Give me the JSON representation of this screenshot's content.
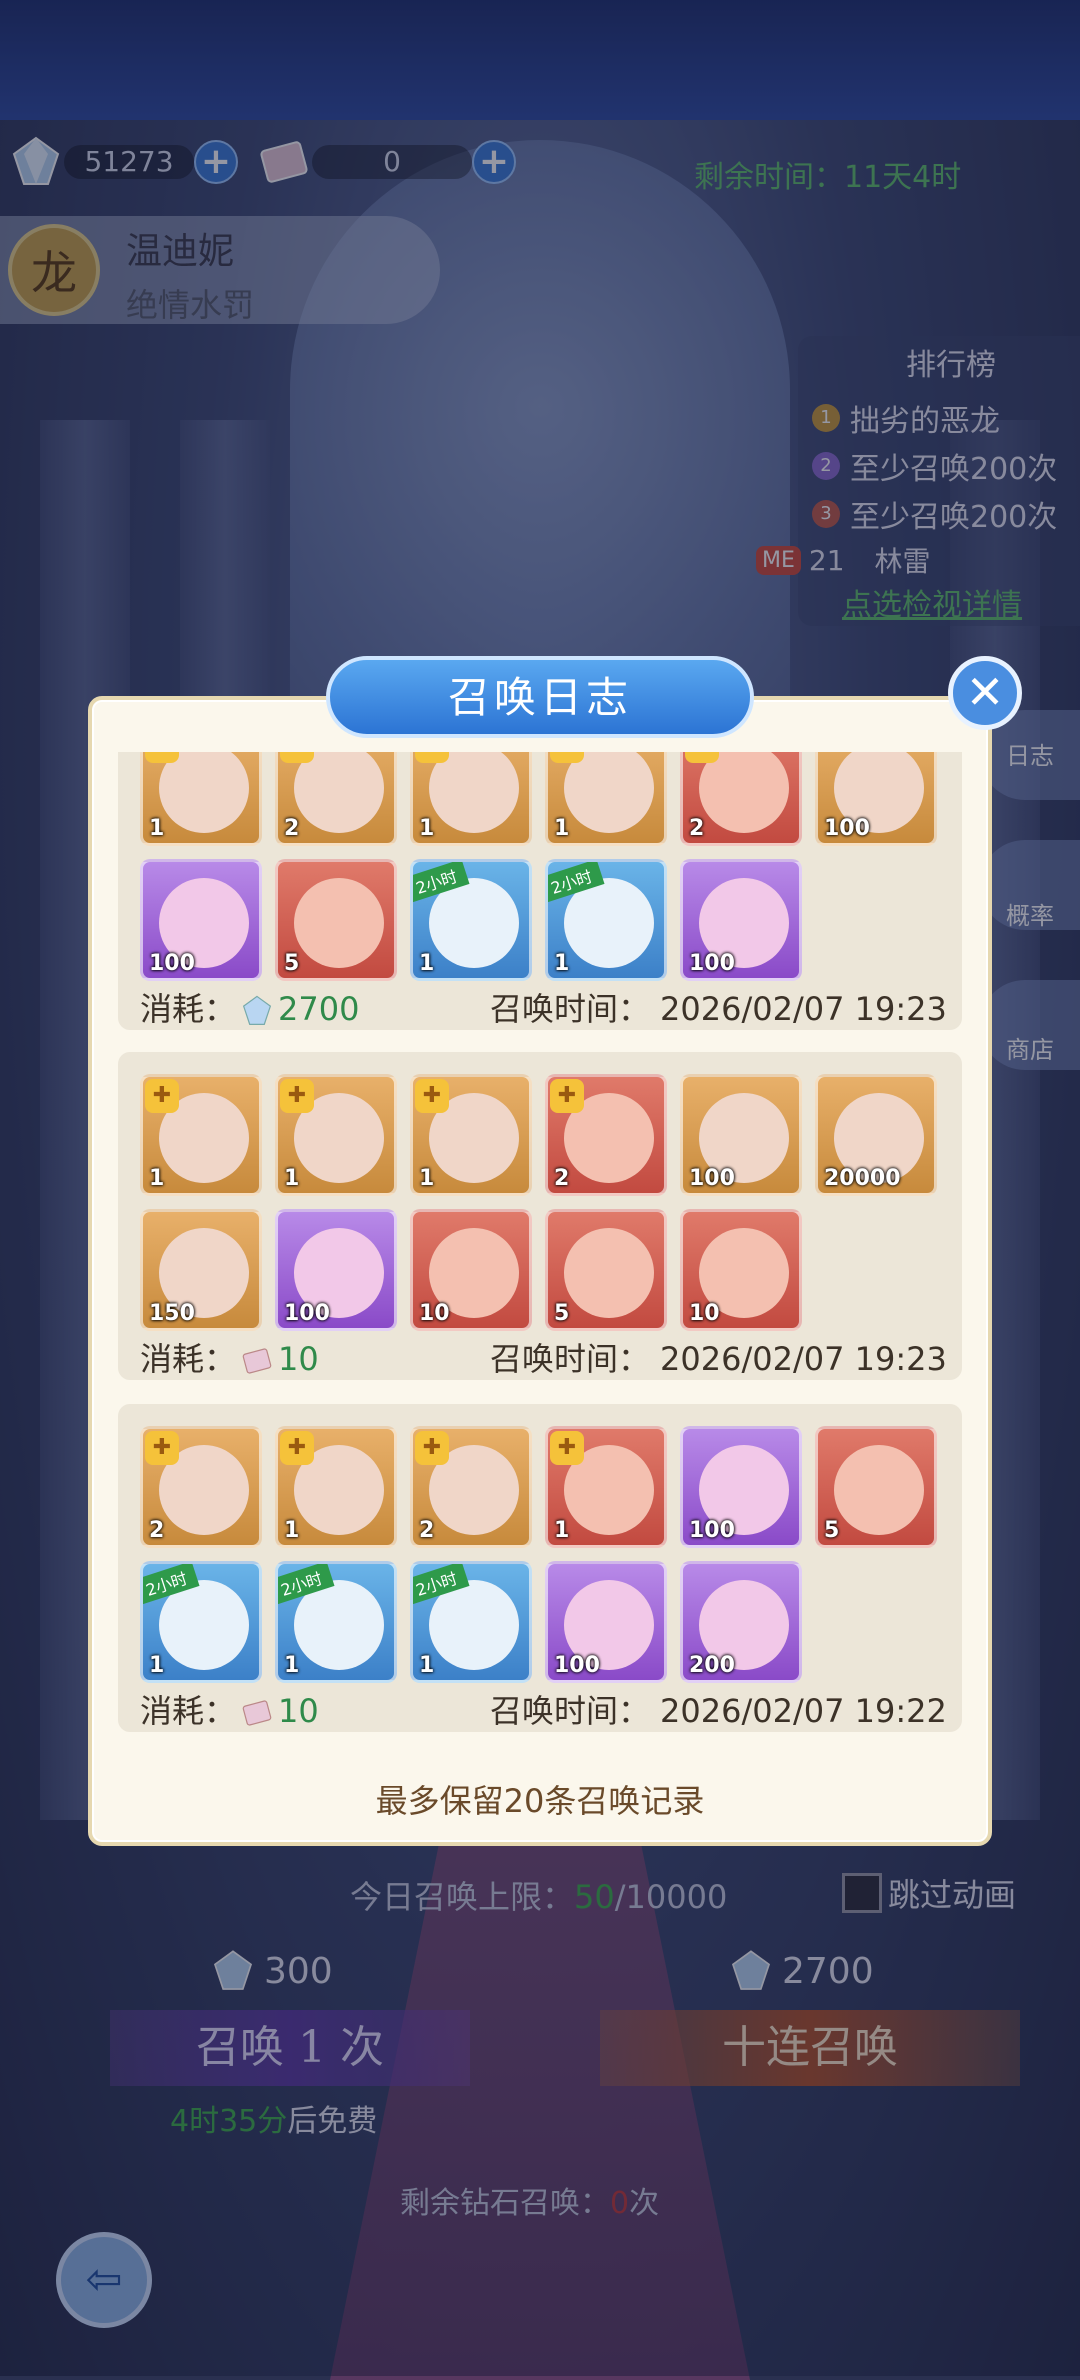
{
  "hud": {
    "diamonds": "51273",
    "tickets": "0",
    "time_left": "剩余时间：11天4时"
  },
  "hero": {
    "name": "温迪妮",
    "subtitle": "绝情水罚"
  },
  "ranking": {
    "title": "排行榜",
    "rows": [
      {
        "rank": "1",
        "text": "拙劣的恶龙"
      },
      {
        "rank": "2",
        "text": "至少召唤200次"
      },
      {
        "rank": "3",
        "text": "至少召唤200次"
      }
    ],
    "me_badge": "ME",
    "me_rank": "21",
    "me_name": "林雷",
    "detail_link": "点选检视详情"
  },
  "side": {
    "log": "日志",
    "prob": "概率",
    "shop": "商店"
  },
  "modal": {
    "title": "召唤日志",
    "cost_label": "消耗：",
    "time_label": "召唤时间：",
    "footer": "最多保留20条召唤记录",
    "entries": [
      {
        "cost": "2700",
        "time": "2026/02/07 19:23",
        "row1": [
          "1",
          "2",
          "1",
          "1",
          "2",
          "100"
        ],
        "row2": [
          "100",
          "5",
          "1",
          "1",
          "100"
        ]
      },
      {
        "cost": "10",
        "time": "2026/02/07 19:23",
        "row1": [
          "1",
          "1",
          "1",
          "2",
          "100",
          "20000"
        ],
        "row2": [
          "150",
          "100",
          "10",
          "5",
          "10"
        ]
      },
      {
        "cost": "10",
        "time": "2026/02/07 19:22",
        "row1": [
          "2",
          "1",
          "2",
          "1",
          "100",
          "5"
        ],
        "row2": [
          "1",
          "1",
          "1",
          "100",
          "200"
        ]
      }
    ],
    "tag_2h": "2小时"
  },
  "bottom": {
    "limit_label": "今日召唤上限：",
    "limit_used": "50",
    "limit_total": "/10000",
    "skip": "跳过动画",
    "cost_once": "300",
    "cost_ten": "2700",
    "btn_once": "召唤 1 次",
    "btn_ten": "十连召唤",
    "free_time": "4时35分",
    "free_suffix": "后免费",
    "diamond_label": "剩余钻石召唤：",
    "diamond_count": "0",
    "diamond_unit": "次"
  },
  "colors": {
    "accent_blue": "#2c74d4",
    "green_text": "#2f8a4a",
    "panel_bg": "#fbf7ec"
  }
}
